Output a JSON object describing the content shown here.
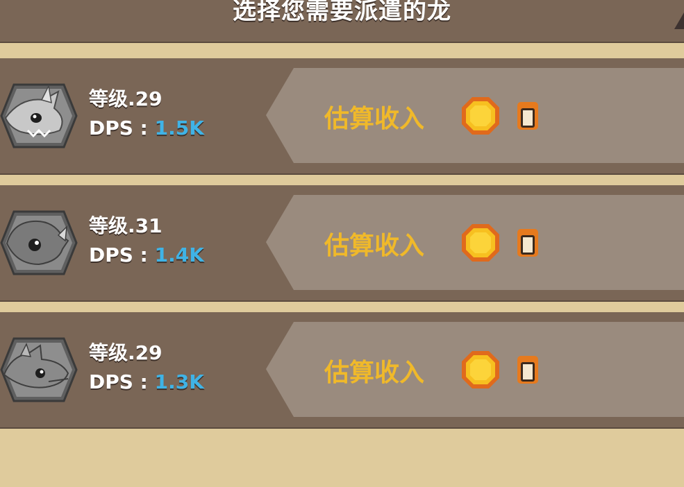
{
  "header": {
    "title": "选择您需要派遣的龙"
  },
  "dragons": [
    {
      "level_text": "等级.29",
      "dps_label": "DPS : ",
      "dps_value": "1.5K",
      "income_label": "估算收入",
      "income_value": ""
    },
    {
      "level_text": "等级.31",
      "dps_label": "DPS : ",
      "dps_value": "1.4K",
      "income_label": "估算收入",
      "income_value": ""
    },
    {
      "level_text": "等级.29",
      "dps_label": "DPS : ",
      "dps_value": "1.3K",
      "income_label": "估算收入",
      "income_value": ""
    }
  ],
  "icons": {
    "avatar": "dragon-portrait-icon",
    "coin": "gold-coin-icon"
  },
  "colors": {
    "header_bg": "#7a6656",
    "row_bg": "#7a6656",
    "page_bg": "#dfcb9c",
    "income_label": "#f0b92a",
    "dps_value": "#3fb3e6",
    "coin": "#f7c020",
    "coin_rim": "#e06a1c"
  }
}
